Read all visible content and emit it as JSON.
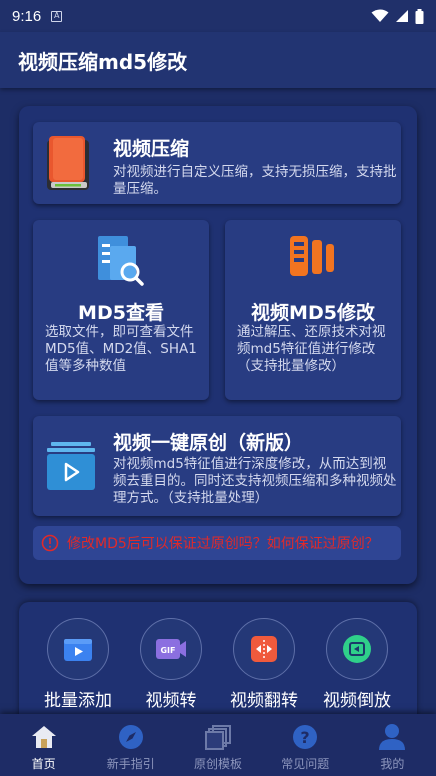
{
  "status_bar": {
    "time": "9:16",
    "notif_glyph": "A"
  },
  "app_bar": {
    "title": "视频压缩md5修改"
  },
  "cards": {
    "compress": {
      "title": "视频压缩",
      "desc": "对视频进行自定义压缩，支持无损压缩，支持批量压缩。",
      "icon": "book-icon"
    },
    "md5_view": {
      "title": "MD5查看",
      "desc": "选取文件，即可查看文件MD5值、MD2值、SHA1值等多种数值",
      "icon": "file-search-icon"
    },
    "md5_modify": {
      "title": "视频MD5修改",
      "desc": "通过解压、还原技术对视频md5特征值进行修改（支持批量修改）",
      "icon": "film-strips-icon"
    },
    "original": {
      "title": "视频一键原创（新版）",
      "desc": "对视频md5特征值进行深度修改，从而达到视频去重目的。同时还支持视频压缩和多种视频处理方式。（支持批量处理）",
      "icon": "video-play-icon"
    }
  },
  "notice": {
    "text": "修改MD5后可以保证过原创吗？如何保证过原创？"
  },
  "tools": [
    {
      "label": "批量添加",
      "icon": "video-add-icon"
    },
    {
      "label": "视频转",
      "icon": "gif-icon"
    },
    {
      "label": "视频翻转",
      "icon": "flip-icon"
    },
    {
      "label": "视频倒放",
      "icon": "reverse-icon"
    }
  ],
  "nav": [
    {
      "label": "首页",
      "icon": "home-icon",
      "active": true
    },
    {
      "label": "新手指引",
      "icon": "compass-icon",
      "active": false
    },
    {
      "label": "原创模板",
      "icon": "template-icon",
      "active": false
    },
    {
      "label": "常见问题",
      "icon": "question-icon",
      "active": false
    },
    {
      "label": "我的",
      "icon": "user-icon",
      "active": false
    }
  ],
  "colors": {
    "background": "#1d2d66",
    "panel": "#1f3172",
    "card": "#283c82",
    "warning": "#e02a2a",
    "nav_bg": "#1e2c66"
  }
}
